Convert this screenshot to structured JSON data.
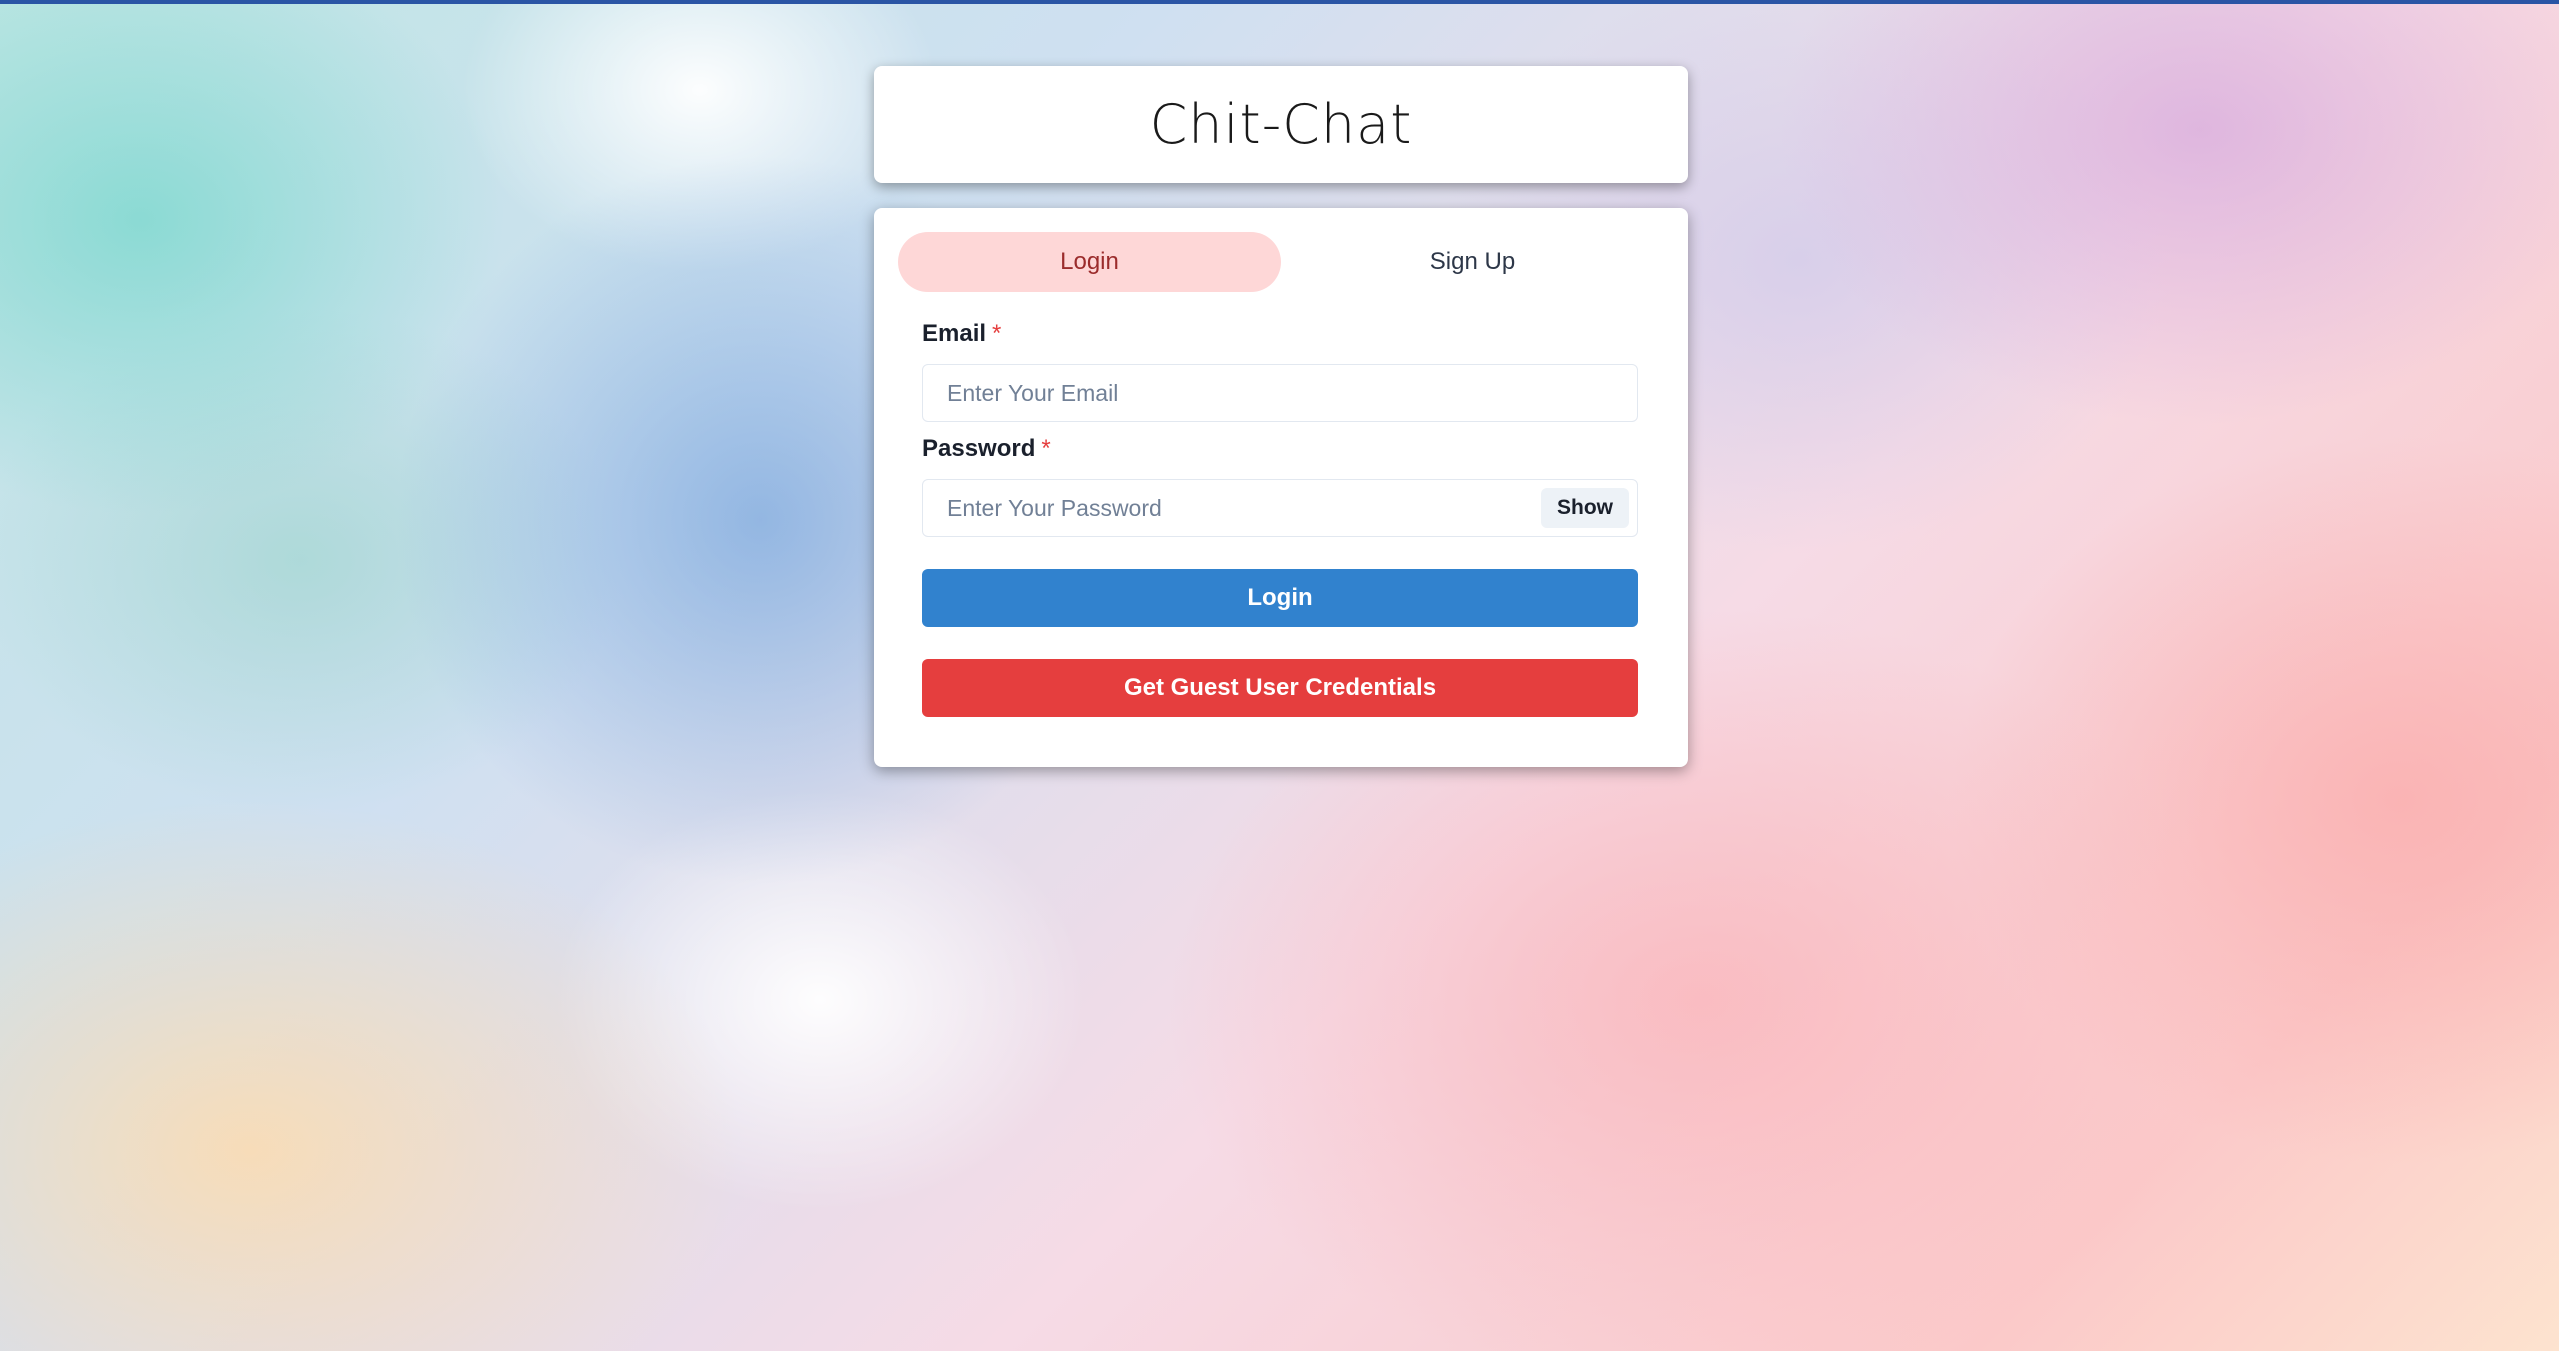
{
  "app": {
    "title": "Chit-Chat"
  },
  "tabs": [
    {
      "label": "Login",
      "active": true
    },
    {
      "label": "Sign Up",
      "active": false
    }
  ],
  "form": {
    "email": {
      "label": "Email",
      "required_mark": "*",
      "value": "",
      "placeholder": "Enter Your Email"
    },
    "password": {
      "label": "Password",
      "required_mark": "*",
      "value": "",
      "placeholder": "Enter Your Password",
      "toggle_label": "Show"
    },
    "login_button": "Login",
    "guest_button": "Get Guest User Credentials"
  },
  "colors": {
    "top_bar": "#2a55a5",
    "active_tab_bg": "#fed7d7",
    "active_tab_text": "#9b2c2c",
    "login_button": "#3182ce",
    "guest_button": "#e53e3e",
    "required_mark": "#e53e3e"
  }
}
